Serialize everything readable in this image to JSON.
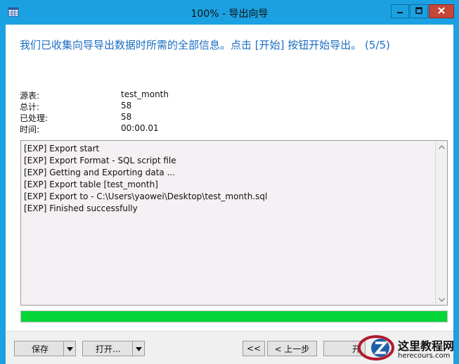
{
  "window": {
    "title": "100% - 导出向导",
    "minimize_icon": "minimize-icon",
    "maximize_icon": "maximize-icon",
    "close_icon": "close-icon",
    "app_icon": "table-grid-icon"
  },
  "headline": "我们已收集向导导出数据时所需的全部信息。点击 [开始] 按钮开始导出。 (5/5)",
  "summary": {
    "source_label": "源表:",
    "source_value": "test_month",
    "total_label": "总计:",
    "total_value": "58",
    "processed_label": "已处理:",
    "processed_value": "58",
    "time_label": "时间:",
    "time_value": "00:00.01"
  },
  "log": [
    "[EXP] Export start",
    "[EXP] Export Format - SQL script file",
    "[EXP] Getting and Exporting data ...",
    "[EXP] Export table [test_month]",
    "[EXP] Export to - C:\\Users\\yaowei\\Desktop\\test_month.sql",
    "[EXP] Finished successfully"
  ],
  "progress": {
    "percent": 100,
    "color": "#06d63a"
  },
  "buttons": {
    "save": "保存",
    "open": "打开...",
    "first": "<<",
    "prev": "< 上一步",
    "start_partial": "开"
  },
  "watermark": {
    "title": "这里教程网",
    "url": "herecours.com"
  },
  "colors": {
    "titlebar": "#1ba1e2",
    "headline": "#1b6ec2",
    "close_button": "#c7463a"
  }
}
